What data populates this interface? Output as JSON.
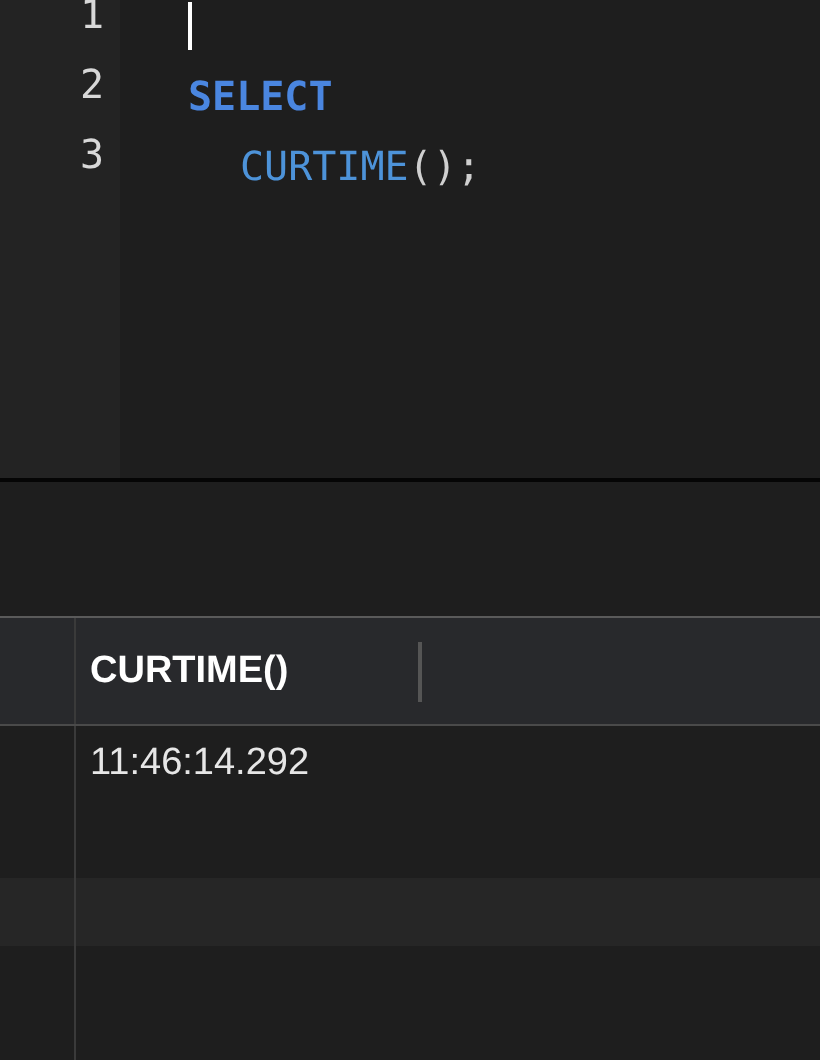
{
  "editor": {
    "lines": [
      {
        "number": "1",
        "cursor": true,
        "indented": false
      },
      {
        "number": "2",
        "cursor": false,
        "indented": false,
        "tokens": [
          {
            "kind": "keyword",
            "text": "SELECT"
          }
        ]
      },
      {
        "number": "3",
        "cursor": false,
        "indented": true,
        "tokens": [
          {
            "kind": "function",
            "text": "CURTIME"
          },
          {
            "kind": "punct",
            "text": "();"
          }
        ]
      }
    ]
  },
  "results": {
    "columns": [
      "CURTIME()"
    ],
    "rows": [
      {
        "cells": [
          "11:46:14.292"
        ]
      }
    ]
  }
}
